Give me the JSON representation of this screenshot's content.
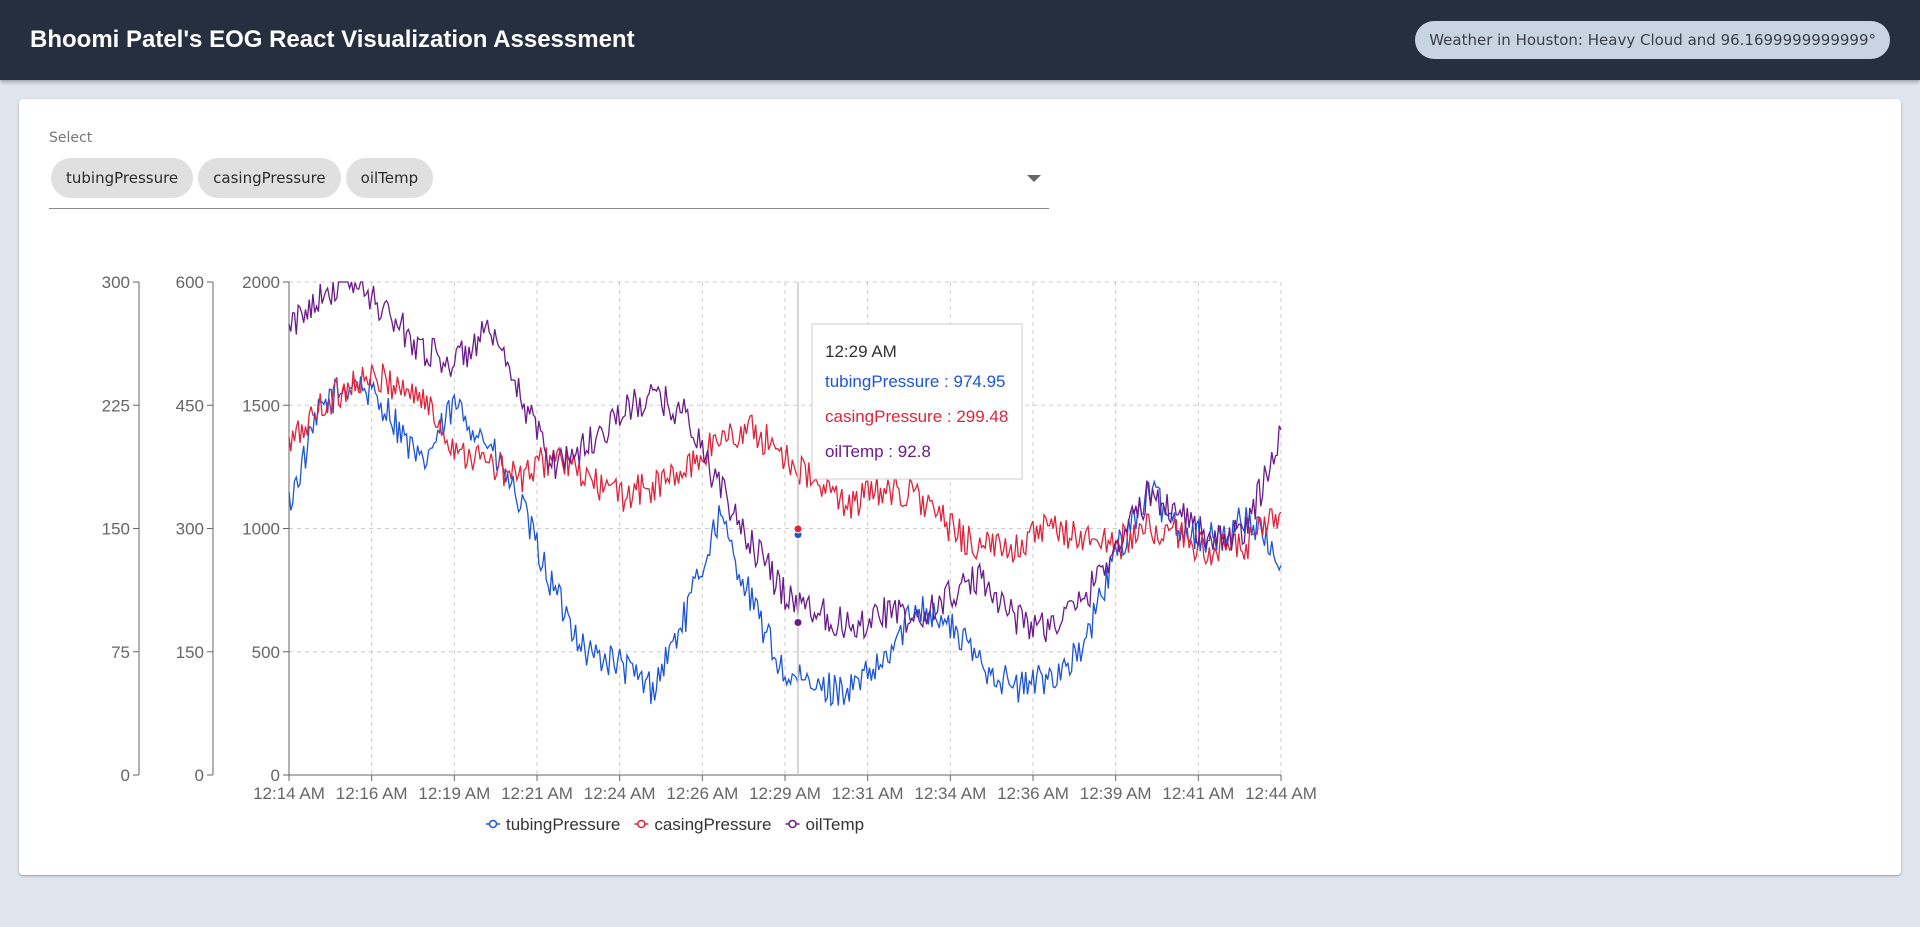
{
  "header": {
    "title": "Bhoomi Patel's EOG React Visualization Assessment",
    "weather": "Weather in Houston: Heavy Cloud and 96.1699999999999°"
  },
  "select": {
    "label": "Select",
    "chips": [
      "tubingPressure",
      "casingPressure",
      "oilTemp"
    ]
  },
  "colors": {
    "tubingPressure": "#1c55d8",
    "casingPressure": "#e0233b",
    "oilTemp": "#6a1b8a",
    "appbar": "#262f3f",
    "background": "#e1e5ee"
  },
  "tooltip": {
    "time": "12:29 AM",
    "lines": [
      {
        "series": "tubingPressure",
        "text": "tubingPressure : 974.95"
      },
      {
        "series": "casingPressure",
        "text": "casingPressure : 299.48"
      },
      {
        "series": "oilTemp",
        "text": "oilTemp : 92.8"
      }
    ]
  },
  "chart_data": {
    "type": "line",
    "x_ticks": [
      "12:14 AM",
      "12:16 AM",
      "12:19 AM",
      "12:21 AM",
      "12:24 AM",
      "12:26 AM",
      "12:29 AM",
      "12:31 AM",
      "12:34 AM",
      "12:36 AM",
      "12:39 AM",
      "12:41 AM",
      "12:44 AM"
    ],
    "grid": true,
    "legend_position": "bottom",
    "axes": [
      {
        "id": "temp",
        "ylim": [
          0,
          300
        ],
        "ticks": [
          0,
          75,
          150,
          225,
          300
        ]
      },
      {
        "id": "casing",
        "ylim": [
          0,
          600
        ],
        "ticks": [
          0,
          150,
          300,
          450,
          600
        ]
      },
      {
        "id": "tubing",
        "ylim": [
          0,
          2000
        ],
        "ticks": [
          0,
          500,
          1000,
          1500,
          2000
        ]
      }
    ],
    "x_minutes": [
      0,
      1,
      2,
      3,
      4,
      5,
      6,
      7,
      8,
      9,
      10,
      11,
      12,
      13,
      14,
      15,
      16,
      17,
      18,
      19,
      20,
      21,
      22,
      23,
      24,
      25,
      26,
      27,
      28,
      29,
      30
    ],
    "series": [
      {
        "name": "tubingPressure",
        "axis": "tubing",
        "color": "#1c55d8",
        "values": [
          1100,
          1500,
          1600,
          1480,
          1250,
          1500,
          1350,
          1100,
          750,
          500,
          450,
          350,
          650,
          1050,
          700,
          400,
          350,
          350,
          450,
          700,
          600,
          450,
          350,
          400,
          500,
          900,
          1150,
          1000,
          950,
          1050,
          850
        ]
      },
      {
        "name": "casingPressure",
        "axis": "casing",
        "color": "#e0233b",
        "values": [
          400,
          450,
          480,
          480,
          460,
          400,
          380,
          360,
          390,
          360,
          340,
          350,
          370,
          410,
          420,
          390,
          350,
          330,
          350,
          340,
          300,
          275,
          280,
          299.5,
          290,
          280,
          300,
          290,
          270,
          280,
          320
        ]
      },
      {
        "name": "oilTemp",
        "axis": "temp",
        "color": "#6a1b8a",
        "values": [
          270,
          295,
          300,
          280,
          260,
          250,
          270,
          230,
          190,
          200,
          220,
          230,
          220,
          175,
          140,
          110,
          100,
          90,
          100,
          92.8,
          110,
          120,
          95,
          90,
          105,
          140,
          170,
          160,
          140,
          150,
          210
        ]
      }
    ]
  }
}
